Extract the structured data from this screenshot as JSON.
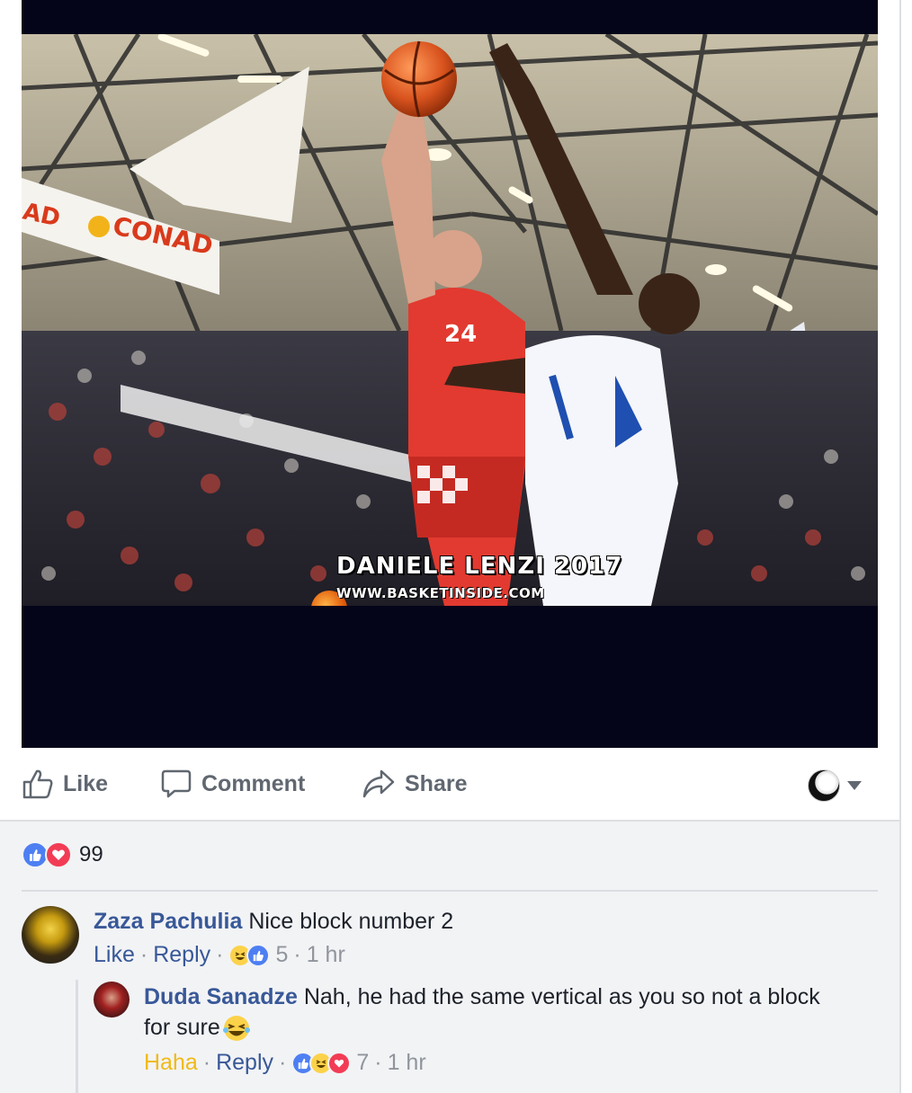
{
  "photo": {
    "banner_left": "AD",
    "sponsor": "CONAD",
    "jersey_number": "24",
    "watermark": {
      "line1": "DANIELE LENZI 2017",
      "line2": "WWW.BASKETINSIDE.COM"
    }
  },
  "actions": {
    "like": "Like",
    "comment": "Comment",
    "share": "Share"
  },
  "reactions": {
    "icons": [
      "like-icon",
      "love-icon"
    ],
    "count": "99"
  },
  "comments": [
    {
      "author": "Zaza Pachulia",
      "text": "Nice block number 2",
      "like_label": "Like",
      "reply_label": "Reply",
      "reaction_icons": [
        "haha-icon",
        "like-icon"
      ],
      "reaction_count": "5",
      "time": "1 hr"
    },
    {
      "author": "Duda Sanadze",
      "text": "Nah, he had the same vertical as you so not a block for sure",
      "emoji": "laughing-emoji",
      "like_label": "Haha",
      "reply_label": "Reply",
      "reaction_icons": [
        "like-icon",
        "haha-icon",
        "love-icon"
      ],
      "reaction_count": "7",
      "time": "1 hr"
    }
  ],
  "colors": {
    "link": "#385898",
    "haha": "#f0ba15",
    "like": "#4e7ff2",
    "love": "#f23c55",
    "muted": "#90949c"
  }
}
